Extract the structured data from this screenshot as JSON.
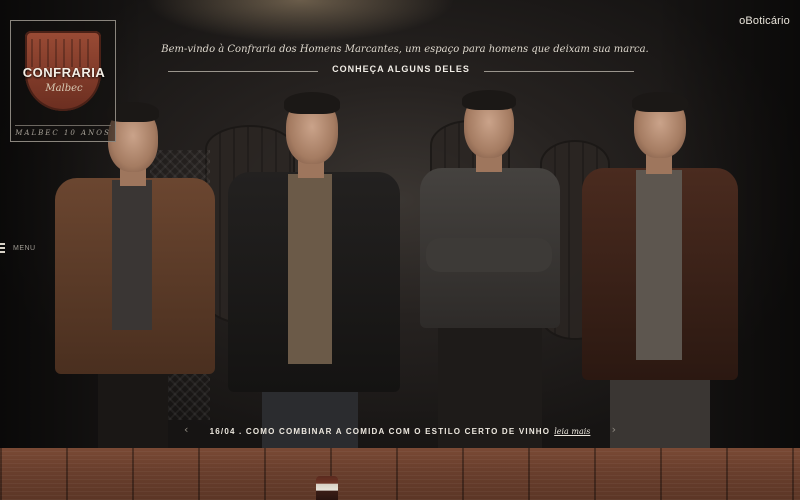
{
  "header": {
    "welcome_text": "Bem-vindo à Confraria dos Homens Marcantes, um espaço para homens que deixam sua marca.",
    "cta_label": "CONHEÇA ALGUNS DELES",
    "brand": "oBoticário"
  },
  "logo": {
    "title": "CONFRARIA",
    "script": "Malbec",
    "footer": "MALBEC 10 ANOS"
  },
  "nav": {
    "menu_label": "MENU"
  },
  "ticker": {
    "text": "16/04 . COMO COMBINAR A COMIDA COM O ESTILO CERTO DE VINHO",
    "link_label": "leia mais",
    "prev_icon": "chevron-left-icon",
    "next_icon": "chevron-right-icon"
  },
  "men": [
    {
      "jacket_color": "#5a3b26",
      "shirt_color": "#3a3634"
    },
    {
      "jacket_color": "#1c1a19",
      "shirt_color": "#6b5a48"
    },
    {
      "jacket_color": "#3a3735",
      "shirt_color": "#3a3735"
    },
    {
      "jacket_color": "#3b2219",
      "shirt_color": "#5d564f"
    }
  ],
  "colors": {
    "background": "#141312",
    "wood": "#6a3f2d",
    "text": "#e8e3da"
  }
}
